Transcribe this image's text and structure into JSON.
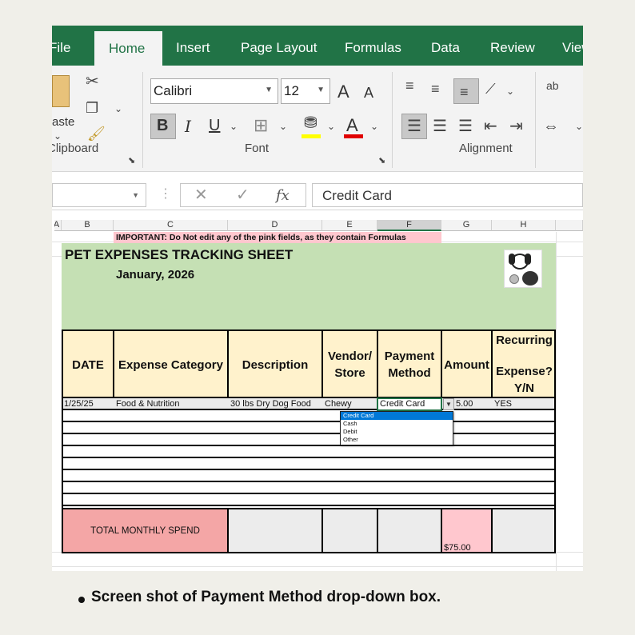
{
  "tabs": [
    "File",
    "Home",
    "Insert",
    "Page Layout",
    "Formulas",
    "Data",
    "Review",
    "View"
  ],
  "ribbon": {
    "paste_label": "Paste",
    "clipboard_label": "Clipboard",
    "font_name": "Calibri",
    "font_size": "12",
    "font_group_label": "Font",
    "alignment_label": "Alignment",
    "bold": "B",
    "italic": "I",
    "underline": "U",
    "grow_font": "A",
    "shrink_font": "A",
    "font_color": "A",
    "wrap_icon": "ab"
  },
  "formula_bar": {
    "fx": "fx",
    "value": "Credit Card"
  },
  "columns": [
    "A",
    "B",
    "C",
    "D",
    "E",
    "F",
    "G",
    "H"
  ],
  "sheet": {
    "important_note": "IMPORTANT: Do Not edit any of the pink fields, as they contain Formulas",
    "title": "PET EXPENSES TRACKING SHEET",
    "month": "January, 2026",
    "headers": {
      "date": "DATE",
      "category": "Expense Category",
      "description": "Description",
      "vendor": "Vendor/ Store",
      "payment": "Payment Method",
      "amount": "Amount",
      "recurring_1": "Recurring",
      "recurring_2": "Expense? Y/N"
    },
    "row1": {
      "date": "1/25/25",
      "category": "Food & Nutrition",
      "description": "30 lbs Dry Dog Food",
      "vendor": "Chewy",
      "payment": "Credit Card",
      "amount": "5.00",
      "recurring": "YES"
    },
    "dropdown_options": [
      "Credit Card",
      "Cash",
      "Debit",
      "Other"
    ],
    "total_label": "TOTAL MONTHLY SPEND",
    "total_value": "$75.00"
  },
  "caption": "Screen shot of Payment Method drop-down box.",
  "colors": {
    "excel_green": "#217346",
    "header_yellow": "#fff2cc",
    "title_green": "#c5e0b4",
    "pink": "#ffc7ce",
    "total_pink": "#f4a6a6",
    "dropdown_blue": "#0078d7"
  }
}
